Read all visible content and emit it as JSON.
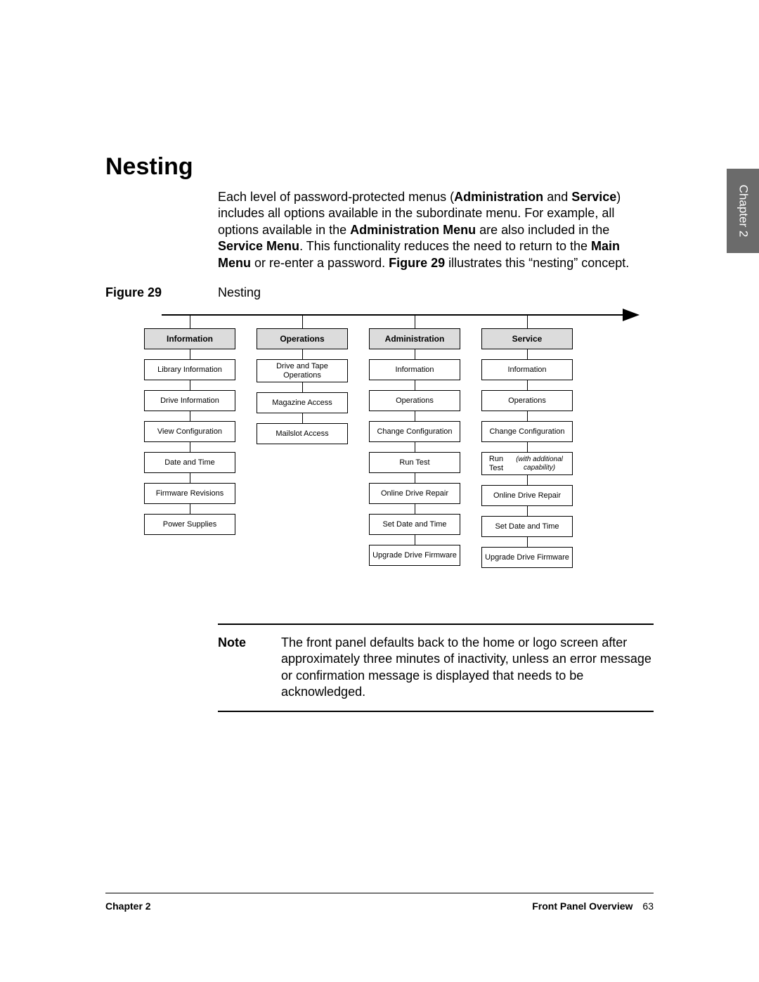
{
  "chapter_tab": "Chapter 2",
  "section_title": "Nesting",
  "paragraph": {
    "t1": "Each level of password-protected menus (",
    "b1": "Administration",
    "t2": " and ",
    "b2": "Service",
    "t3": ") includes all options available in the subordinate menu. For example, all options available in the ",
    "b3": "Administration Menu",
    "t4": " are also included in the ",
    "b4": "Service Menu",
    "t5": ". This functionality reduces the need to return to the ",
    "b5": "Main Menu",
    "t6": " or re-enter a password. ",
    "b6": "Figure 29",
    "t7": " illustrates this “nesting” concept."
  },
  "figure": {
    "label": "Figure 29",
    "title": "Nesting"
  },
  "columns": [
    {
      "header": "Information",
      "items": [
        "Library Information",
        "Drive Information",
        "View Configuration",
        "Date and Time",
        "Firmware Revisions",
        "Power Supplies"
      ]
    },
    {
      "header": "Operations",
      "items": [
        "Drive and Tape Operations",
        "Magazine Access",
        "Mailslot Access"
      ]
    },
    {
      "header": "Administration",
      "items": [
        "Information",
        "Operations",
        "Change Configuration",
        "Run Test",
        "Online Drive Repair",
        "Set Date and Time",
        "Upgrade Drive Firmware"
      ]
    },
    {
      "header": "Service",
      "items": [
        "Information",
        "Operations",
        "Change Configuration",
        "Run Test",
        "Online Drive Repair",
        "Set Date and Time",
        "Upgrade Drive Firmware"
      ],
      "item_suffix_italic": {
        "3": "(with additional capability)"
      }
    }
  ],
  "note": {
    "label": "Note",
    "text": "The front panel defaults back to the home or logo screen after approximately three minutes of inactivity, unless an error message or confirmation message is displayed that needs to be acknowledged."
  },
  "footer": {
    "left": "Chapter 2",
    "right_title": "Front Panel Overview",
    "page_number": "63"
  }
}
